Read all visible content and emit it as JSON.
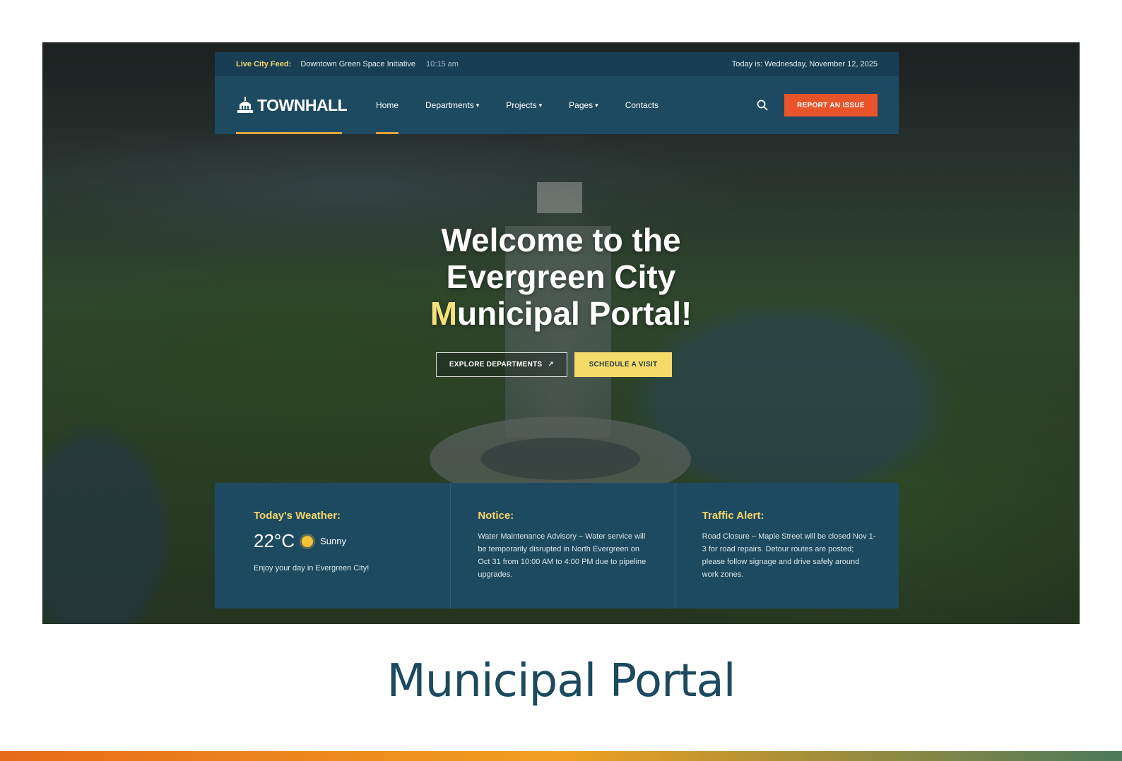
{
  "topbar": {
    "feed_label": "Live City Feed:",
    "feed_text": "Downtown Green Space Initiative",
    "feed_time": "10:15 am",
    "date_text": "Today is: Wednesday, November 12, 2025"
  },
  "brand": {
    "logo_text": "TOWNHALL"
  },
  "nav": {
    "items": [
      {
        "label": "Home",
        "caret": ""
      },
      {
        "label": "Departments",
        "caret": "▾"
      },
      {
        "label": "Projects",
        "caret": "▾"
      },
      {
        "label": "Pages",
        "caret": "▾"
      },
      {
        "label": "Contacts",
        "caret": ""
      }
    ],
    "report_label": "REPORT AN ISSUE"
  },
  "hero": {
    "line1": "Welcome to the",
    "line2": "Evergreen City",
    "line3_accent": "M",
    "line3_rest": "unicipal Portal!",
    "explore_label": "EXPLORE DEPARTMENTS",
    "explore_arrow": "↗",
    "visit_label": "SCHEDULE A VISIT"
  },
  "weather": {
    "title": "Today's Weather:",
    "temp": "22°C",
    "condition": "Sunny",
    "note": "Enjoy your day in Evergreen City!"
  },
  "notice": {
    "title": "Notice:",
    "body": "Water Maintenance Advisory – Water service will be temporarily disrupted in North Evergreen on Oct 31 from 10:00 AM to 4:00 PM due to pipeline upgrades."
  },
  "traffic": {
    "title": "Traffic Alert:",
    "body": "Road Closure – Maple Street will be closed Nov 1-3 for road repairs. Detour routes are posted; please follow signage and drive safely around work zones."
  },
  "caption": "Municipal Portal",
  "colors": {
    "navy": "#1d4a60",
    "accent_orange": "#e8532a",
    "accent_yellow": "#f5db6a",
    "gold": "#f5d46a"
  }
}
